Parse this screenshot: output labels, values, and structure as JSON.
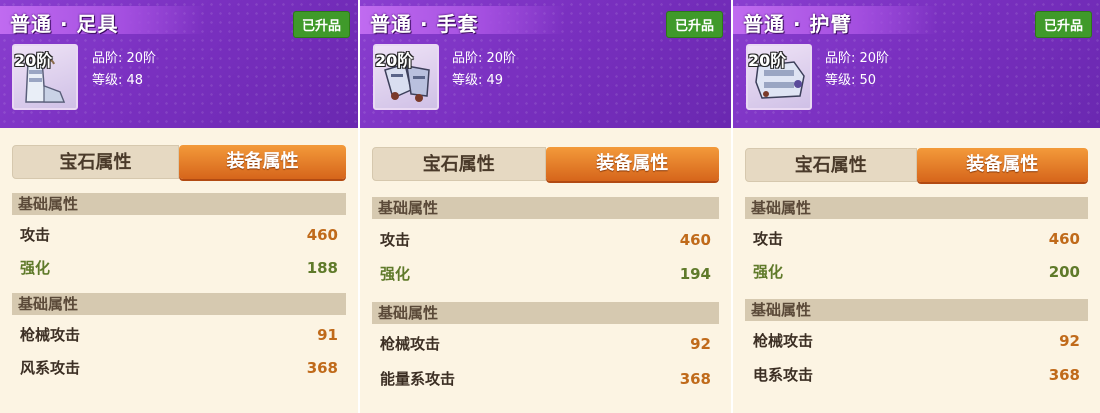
{
  "panels": [
    {
      "title": "普通 · 足具",
      "badge": "已升品",
      "tier": "20阶",
      "icon": "boots-icon",
      "grade": "品阶: 20阶",
      "level": "等级: 48",
      "tabs": {
        "gem": "宝石属性",
        "equip": "装备属性"
      },
      "section1": "基础属性",
      "stats1": [
        {
          "name": "攻击",
          "value": "460"
        },
        {
          "name": "强化",
          "value": "188"
        }
      ],
      "section2": "基础属性",
      "stats2": [
        {
          "name": "枪械攻击",
          "value": "91"
        },
        {
          "name": "风系攻击",
          "value": "368"
        }
      ]
    },
    {
      "title": "普通 · 手套",
      "badge": "已升品",
      "tier": "20阶",
      "icon": "gloves-icon",
      "grade": "品阶: 20阶",
      "level": "等级: 49",
      "tabs": {
        "gem": "宝石属性",
        "equip": "装备属性"
      },
      "section1": "基础属性",
      "stats1": [
        {
          "name": "攻击",
          "value": "460"
        },
        {
          "name": "强化",
          "value": "194"
        }
      ],
      "section2": "基础属性",
      "stats2": [
        {
          "name": "枪械攻击",
          "value": "92"
        },
        {
          "name": "能量系攻击",
          "value": "368"
        }
      ]
    },
    {
      "title": "普通 · 护臂",
      "badge": "已升品",
      "tier": "20阶",
      "icon": "bracer-icon",
      "grade": "品阶: 20阶",
      "level": "等级: 50",
      "tabs": {
        "gem": "宝石属性",
        "equip": "装备属性"
      },
      "section1": "基础属性",
      "stats1": [
        {
          "name": "攻击",
          "value": "460"
        },
        {
          "name": "强化",
          "value": "200"
        }
      ],
      "section2": "基础属性",
      "stats2": [
        {
          "name": "枪械攻击",
          "value": "92"
        },
        {
          "name": "电系攻击",
          "value": "368"
        }
      ]
    }
  ],
  "colors": {
    "header": "#7a33c4",
    "badge": "#3f9a2a",
    "value_orange": "#c06a1a",
    "value_green": "#5f7a2a",
    "tab_active": "#e67a25",
    "tab_inactive": "#e6d9c2",
    "section_bg": "#d6c9b0",
    "panel_bg": "#fcf4e3"
  }
}
